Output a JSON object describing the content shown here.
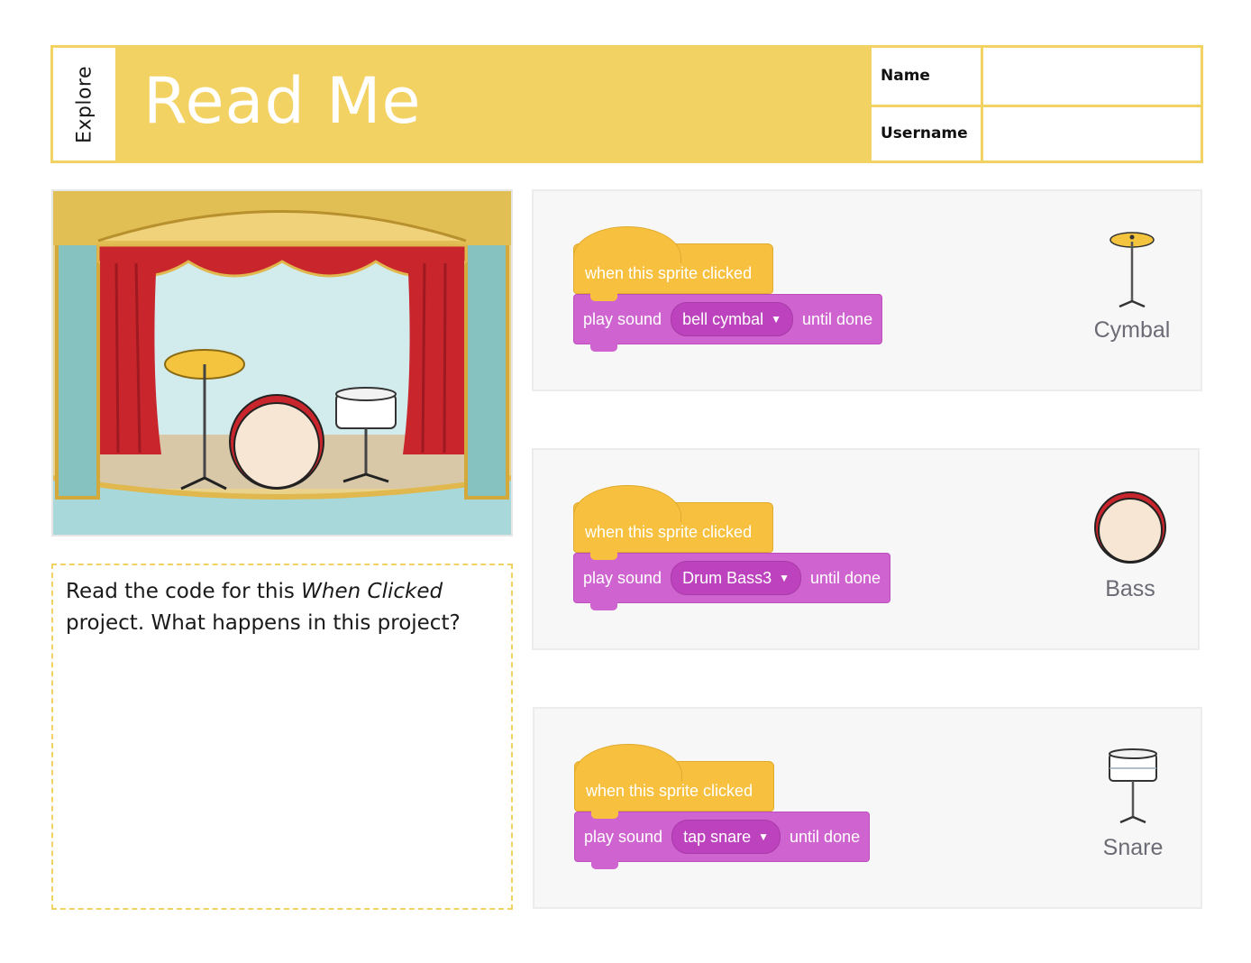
{
  "header": {
    "section": "Explore",
    "title": "Read Me",
    "name_label": "Name",
    "username_label": "Username",
    "name_value": "",
    "username_value": ""
  },
  "question": {
    "part1": "Read the code for this ",
    "italic": "When Clicked",
    "part2": " project. What happens in this project?"
  },
  "scripts": [
    {
      "hat": "when this sprite clicked",
      "action": "play sound",
      "sound": "bell cymbal",
      "suffix": "until done",
      "sprite": "Cymbal"
    },
    {
      "hat": "when this sprite clicked",
      "action": "play sound",
      "sound": "Drum Bass3",
      "suffix": "until done",
      "sprite": "Bass"
    },
    {
      "hat": "when this sprite clicked",
      "action": "play sound",
      "sound": "tap snare",
      "suffix": "until done",
      "sprite": "Snare"
    }
  ],
  "colors": {
    "accent_yellow": "#f3d264",
    "events_block": "#f7c13f",
    "sound_block": "#cf63cf",
    "sound_menu": "#bd42bd",
    "curtain_red": "#c8252c",
    "stage_wall": "#cfe8ea"
  },
  "icons": [
    "dropdown-arrow-icon",
    "cymbal-icon",
    "bass-drum-icon",
    "snare-drum-icon"
  ]
}
